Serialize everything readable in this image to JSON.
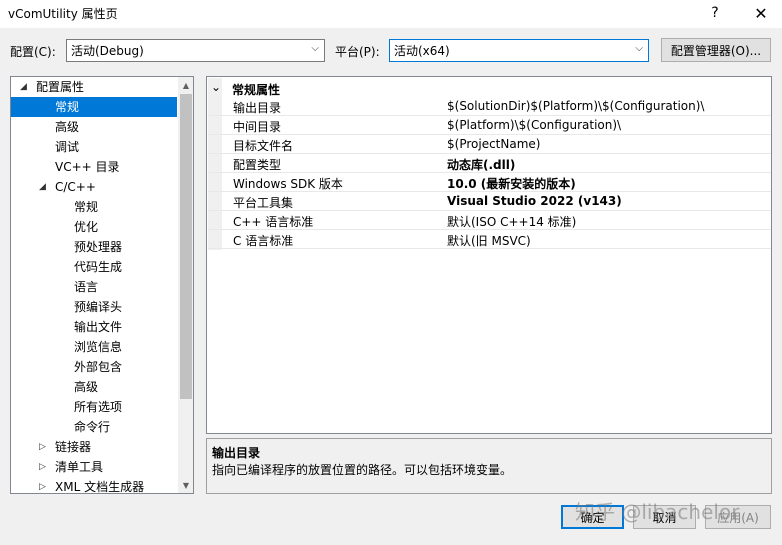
{
  "window": {
    "title": "vComUtility 属性页",
    "help_glyph": "?",
    "close_glyph": "✕"
  },
  "config_row": {
    "config_label": "配置(C):",
    "config_value": "活动(Debug)",
    "platform_label": "平台(P):",
    "platform_value": "活动(x64)",
    "manager_button": "配置管理器(O)..."
  },
  "tree": {
    "items": [
      {
        "label": "配置属性",
        "expander": "◢"
      },
      {
        "label": "常规",
        "selected": true
      },
      {
        "label": "高级"
      },
      {
        "label": "调试"
      },
      {
        "label": "VC++ 目录"
      },
      {
        "label": "C/C++",
        "expander": "◢"
      },
      {
        "label": "常规"
      },
      {
        "label": "优化"
      },
      {
        "label": "预处理器"
      },
      {
        "label": "代码生成"
      },
      {
        "label": "语言"
      },
      {
        "label": "预编译头"
      },
      {
        "label": "输出文件"
      },
      {
        "label": "浏览信息"
      },
      {
        "label": "外部包含"
      },
      {
        "label": "高级"
      },
      {
        "label": "所有选项"
      },
      {
        "label": "命令行"
      },
      {
        "label": "链接器",
        "expander": "▷"
      },
      {
        "label": "清单工具",
        "expander": "▷"
      },
      {
        "label": "XML 文档生成器",
        "expander": "▷"
      }
    ]
  },
  "grid": {
    "section_expander": "⌄",
    "section_title": "常规属性",
    "rows": [
      {
        "name": "输出目录",
        "value": "$(SolutionDir)$(Platform)\\$(Configuration)\\"
      },
      {
        "name": "中间目录",
        "value": "$(Platform)\\$(Configuration)\\"
      },
      {
        "name": "目标文件名",
        "value": "$(ProjectName)"
      },
      {
        "name": "配置类型",
        "value": "动态库(.dll)"
      },
      {
        "name": "Windows SDK 版本",
        "value": "10.0 (最新安装的版本)"
      },
      {
        "name": "平台工具集",
        "value": "Visual Studio 2022 (v143)"
      },
      {
        "name": "C++ 语言标准",
        "value": "默认(ISO C++14 标准)"
      },
      {
        "name": "C 语言标准",
        "value": "默认(旧 MSVC)"
      }
    ]
  },
  "description": {
    "title": "输出目录",
    "text": "指向已编译程序的放置位置的路径。可以包括环境变量。"
  },
  "buttons": {
    "ok": "确定",
    "cancel": "取消",
    "apply": "应用(A)"
  },
  "watermark": "知乎 @libachelor",
  "colors": {
    "selection": "#0078d7",
    "window_bg": "#f0f0f0",
    "pane_bg": "#ffffff"
  }
}
